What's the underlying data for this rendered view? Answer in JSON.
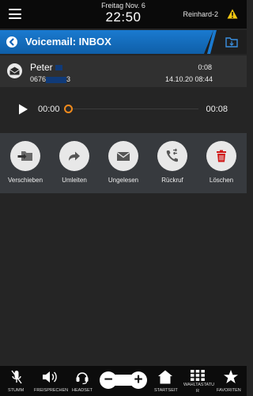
{
  "status_bar": {
    "date": "Freitag Nov. 6",
    "time": "22:50",
    "user": "Reinhard-2",
    "menu_icon": "hamburger-menu-icon",
    "alert_icon": "warning-icon"
  },
  "title_bar": {
    "title": "Voicemail: INBOX",
    "back_icon": "back-arrow-icon",
    "folder_icon": "folder-icon",
    "accent_color": "#1a7ad0"
  },
  "message": {
    "caller_name": "Peter",
    "caller_number_prefix": "0676",
    "caller_number_suffix": "3",
    "duration": "0:08",
    "received": "14.10.20 08:44",
    "icon": "voicemail-envelope-icon"
  },
  "player": {
    "current_time": "00:00",
    "total_time": "00:08",
    "progress": 0,
    "thumb_color": "#f08a1c"
  },
  "actions": [
    {
      "label": "Verschieben",
      "icon": "move-folder-icon"
    },
    {
      "label": "Umleiten",
      "icon": "forward-arrow-icon"
    },
    {
      "label": "Ungelesen",
      "icon": "mark-unread-envelope-icon"
    },
    {
      "label": "Rückruf",
      "icon": "callback-phone-icon"
    },
    {
      "label": "Löschen",
      "icon": "trash-icon"
    }
  ],
  "toolbar": {
    "mute": "STUMM",
    "speaker": "FREISPRECHEN",
    "headset": "HEADSET",
    "home": "STARTSEIT",
    "dialpad_line1": "WAHLTASTATU",
    "dialpad_line2": "R",
    "favorites": "FAVORITEN",
    "volume_down": "−",
    "volume_up": "+"
  }
}
